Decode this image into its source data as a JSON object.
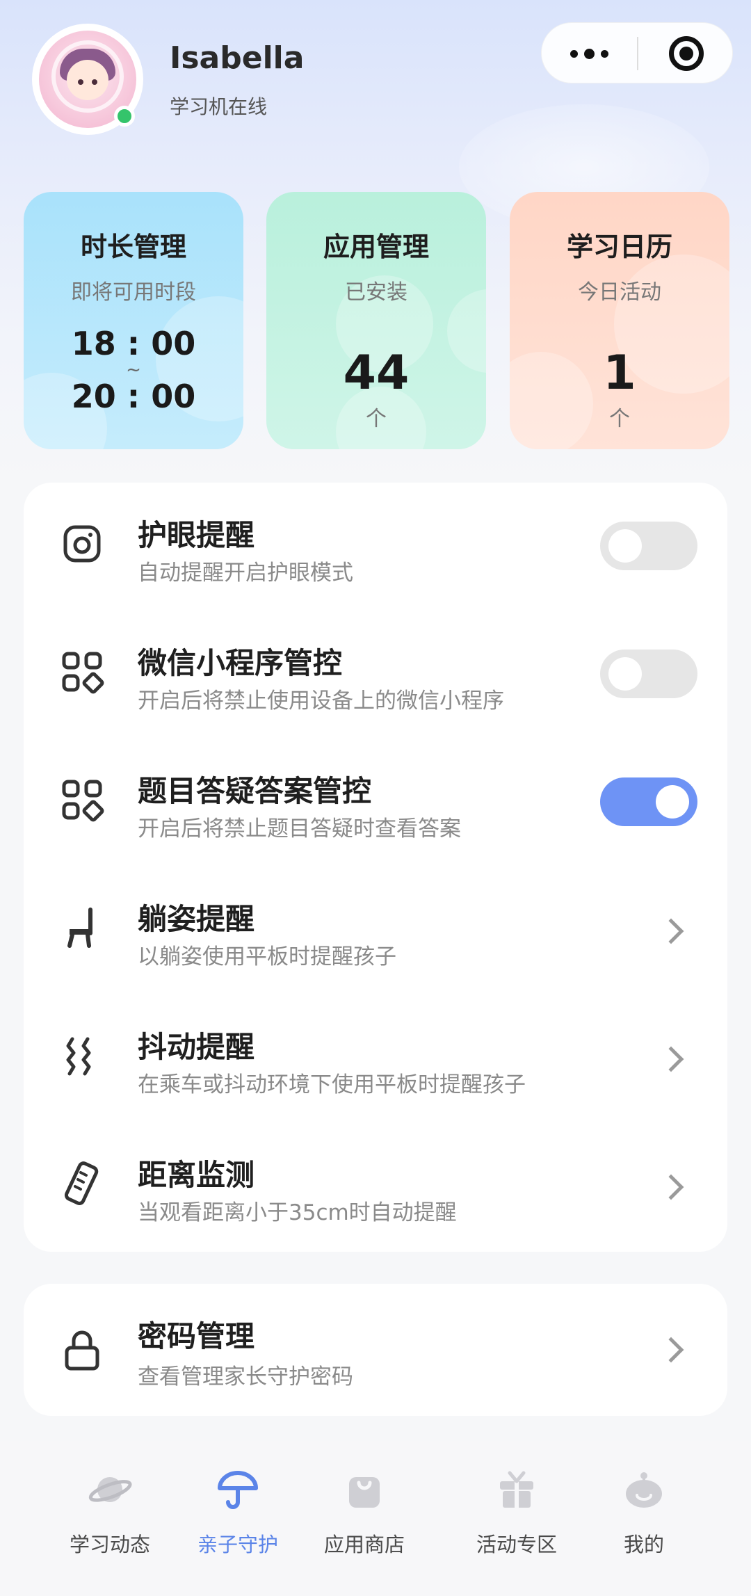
{
  "header": {
    "user_name": "Isabella",
    "status": "学习机在线"
  },
  "stats": {
    "time": {
      "title": "时长管理",
      "subtitle": "即将可用时段",
      "start": "18 : 00",
      "separator": "~",
      "end": "20 : 00"
    },
    "apps": {
      "title": "应用管理",
      "subtitle": "已安装",
      "value": "44",
      "unit": "个"
    },
    "calendar": {
      "title": "学习日历",
      "subtitle": "今日活动",
      "value": "1",
      "unit": "个"
    }
  },
  "settings": [
    {
      "title": "护眼提醒",
      "desc": "自动提醒开启护眼模式",
      "icon": "eye-care-icon",
      "control": "toggle",
      "on": false
    },
    {
      "title": "微信小程序管控",
      "desc": "开启后将禁止使用设备上的微信小程序",
      "icon": "apps-grid-icon",
      "control": "toggle",
      "on": false
    },
    {
      "title": "题目答疑答案管控",
      "desc": "开启后将禁止题目答疑时查看答案",
      "icon": "apps-grid-icon",
      "control": "toggle",
      "on": true
    },
    {
      "title": "躺姿提醒",
      "desc": "以躺姿使用平板时提醒孩子",
      "icon": "chair-icon",
      "control": "chevron"
    },
    {
      "title": "抖动提醒",
      "desc": "在乘车或抖动环境下使用平板时提醒孩子",
      "icon": "shake-icon",
      "control": "chevron"
    },
    {
      "title": "距离监测",
      "desc": "当观看距离小于35cm时自动提醒",
      "icon": "ruler-icon",
      "control": "chevron"
    }
  ],
  "password": {
    "title": "密码管理",
    "desc": "查看管理家长守护密码",
    "icon": "lock-icon"
  },
  "tabs": [
    {
      "label": "学习动态",
      "icon": "planet-icon",
      "active": false
    },
    {
      "label": "亲子守护",
      "icon": "umbrella-icon",
      "active": true
    },
    {
      "label": "应用商店",
      "icon": "bag-icon",
      "active": false
    },
    {
      "label": "活动专区",
      "icon": "gift-icon",
      "active": false
    },
    {
      "label": "我的",
      "icon": "profile-icon",
      "active": false
    }
  ],
  "colors": {
    "accent": "#6e93f5",
    "tab_active": "#5b84e8",
    "online": "#34c46b"
  }
}
